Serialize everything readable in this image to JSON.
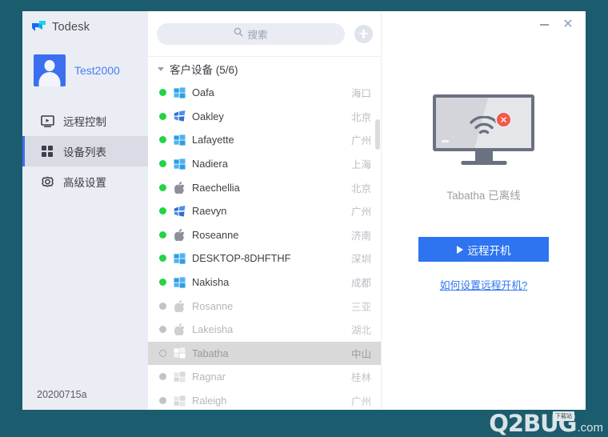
{
  "app": {
    "brand": "Todesk",
    "logo_icon": "todesk-logo-icon",
    "version": "20200715a"
  },
  "titlebar": {
    "minimize_icon": "minimize-icon",
    "close_icon": "close-icon"
  },
  "profile": {
    "name": "Test2000",
    "avatar_icon": "user-avatar-icon"
  },
  "sidebar": {
    "items": [
      {
        "label": "远程控制",
        "icon": "remote-control-icon",
        "active": false
      },
      {
        "label": "设备列表",
        "icon": "device-list-icon",
        "active": true
      },
      {
        "label": "高级设置",
        "icon": "settings-gear-icon",
        "active": false
      }
    ]
  },
  "search": {
    "placeholder": "搜索",
    "value": "",
    "icon": "search-icon",
    "add_button_icon": "plus-icon"
  },
  "device_list": {
    "group": {
      "title": "客户设备 (5/6)",
      "expanded": true,
      "caret_icon": "chevron-down-icon"
    },
    "columns": [
      "status",
      "os",
      "name",
      "location"
    ],
    "rows": [
      {
        "name": "Oafa",
        "location": "海口",
        "os": "windows-10",
        "online": true,
        "selected": false
      },
      {
        "name": "Oakley",
        "location": "北京",
        "os": "windows-7",
        "online": true,
        "selected": false
      },
      {
        "name": "Lafayette",
        "location": "广州",
        "os": "windows-10",
        "online": true,
        "selected": false
      },
      {
        "name": "Nadiera",
        "location": "上海",
        "os": "windows-10",
        "online": true,
        "selected": false
      },
      {
        "name": "Raechellia",
        "location": "北京",
        "os": "apple",
        "online": true,
        "selected": false
      },
      {
        "name": "Raevyn",
        "location": "广州",
        "os": "windows-7",
        "online": true,
        "selected": false
      },
      {
        "name": "Roseanne",
        "location": "济南",
        "os": "apple",
        "online": true,
        "selected": false
      },
      {
        "name": "DESKTOP-8DHFTHF",
        "location": "深圳",
        "os": "windows-10",
        "online": true,
        "selected": false
      },
      {
        "name": "Nakisha",
        "location": "成都",
        "os": "windows-10",
        "online": true,
        "selected": false
      },
      {
        "name": "Rosanne",
        "location": "三亚",
        "os": "apple",
        "online": false,
        "selected": false
      },
      {
        "name": "Lakeisha",
        "location": "湖北",
        "os": "apple",
        "online": false,
        "selected": false
      },
      {
        "name": "Tabatha",
        "location": "中山",
        "os": "windows-10",
        "online": false,
        "selected": true
      },
      {
        "name": "Ragnar",
        "location": "桂林",
        "os": "windows-10",
        "online": false,
        "selected": false
      },
      {
        "name": "Raleigh",
        "location": "广州",
        "os": "windows-10",
        "online": false,
        "selected": false
      }
    ]
  },
  "detail": {
    "illustration_icon": "offline-monitor-icon",
    "status_text": "Tabatha 已离线",
    "power_button": {
      "label": "远程开机",
      "icon": "play-icon"
    },
    "help_link": "如何设置远程开机?"
  },
  "watermark": {
    "text": "Q2BUG",
    "domain": ".com",
    "tag": "下载站"
  },
  "colors": {
    "desktop_bg": "#1b5c6e",
    "sidebar_bg": "#eaedf4",
    "accent_blue": "#2e74f0",
    "online_green": "#23d445",
    "offline_gray": "#c3c3c3",
    "selected_row": "#d9d9d9",
    "error_red": "#f2594b"
  }
}
